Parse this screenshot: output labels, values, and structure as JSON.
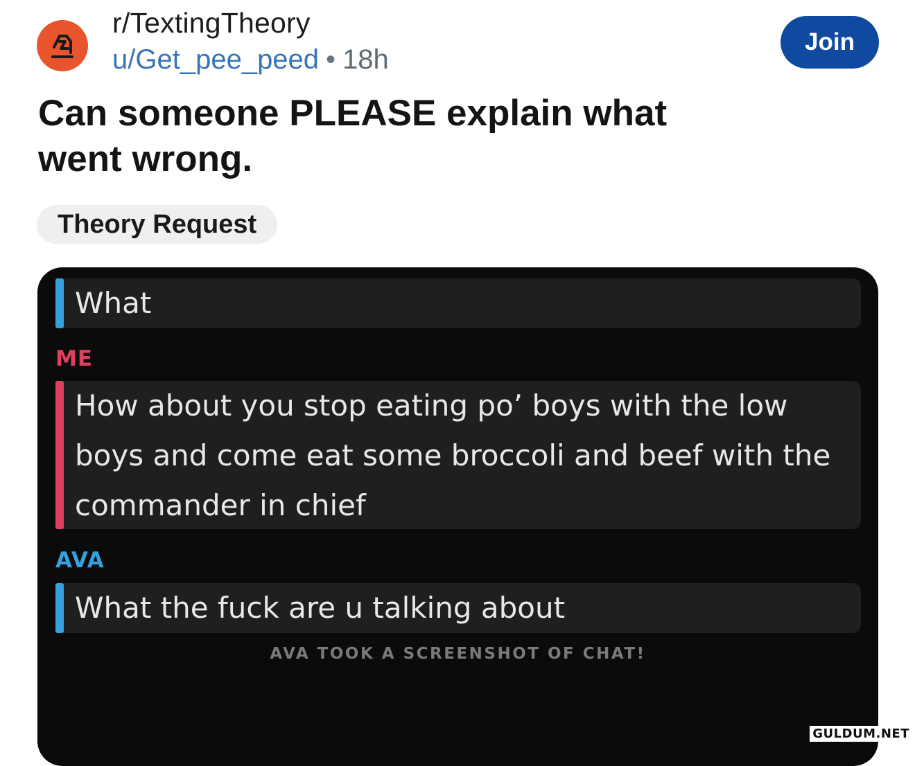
{
  "post": {
    "subreddit": "r/TextingTheory",
    "author": "u/Get_pee_peed",
    "separator": "•",
    "age": "18h",
    "join_label": "Join",
    "title": "Can someone PLEASE explain what went wrong.",
    "flair": "Theory Request"
  },
  "chat": {
    "messages": [
      {
        "sender": "",
        "text": "What",
        "color": "#35a2e0"
      },
      {
        "sender": "ME",
        "text": "How about you stop eating po’ boys with the low boys and come eat some broccoli and beef with the commander in chief",
        "color": "#e0405e"
      },
      {
        "sender": "AVA",
        "text": "What the fuck are u talking about",
        "color": "#35a2e0"
      }
    ],
    "notice": "AVA TOOK A SCREENSHOT OF CHAT!"
  },
  "watermark": "GULDUM.NET",
  "colors": {
    "join_bg": "#0f4aa0",
    "avatar_bg": "#e8542c",
    "me_accent": "#e0405e",
    "ava_accent": "#35a2e0"
  },
  "icons": {
    "avatar": "texting-theory-chess-knight-icon"
  }
}
